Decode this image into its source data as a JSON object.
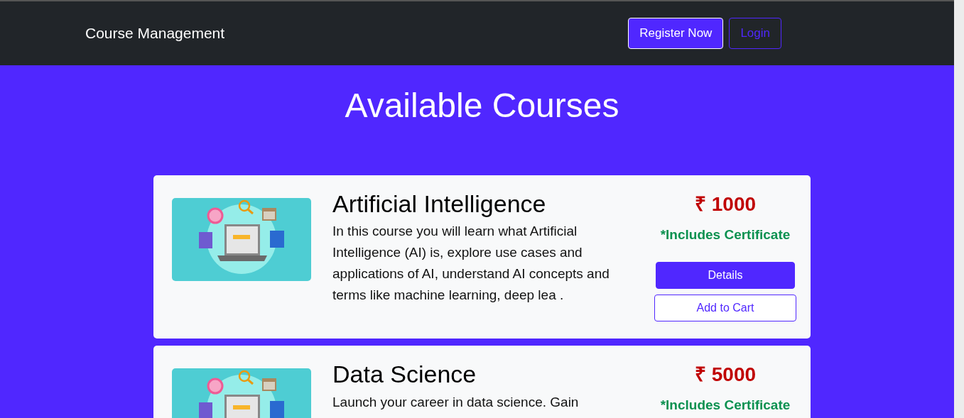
{
  "navbar": {
    "brand": "Course Management",
    "buttons": [
      {
        "label": "Register Now",
        "kind": "filled"
      },
      {
        "label": "Login",
        "kind": "outline"
      }
    ]
  },
  "heading": "Available Courses",
  "courses": [
    {
      "title": "Artificial Intelligence",
      "description": "In this course you will learn what Artificial Intelligence (AI) is, explore use cases and applications of AI, understand AI concepts and terms like machine learning, deep lea .",
      "price": "₹ 1000",
      "note": "*Includes Certificate",
      "buttons": [
        {
          "label": "Details",
          "kind": "filled"
        },
        {
          "label": "Add to Cart",
          "kind": "outline"
        }
      ]
    },
    {
      "title": "Data Science",
      "description": "Launch your career in data science. Gain",
      "price": "₹ 5000",
      "note": "*Includes Certificate"
    }
  ]
}
